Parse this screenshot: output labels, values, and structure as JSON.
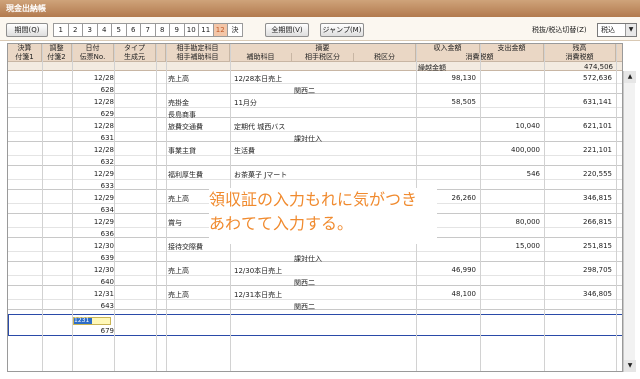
{
  "window": {
    "title": "現金出納帳"
  },
  "toolbar": {
    "period_label": "期間(Q)",
    "months": [
      "1",
      "2",
      "3",
      "4",
      "5",
      "6",
      "7",
      "8",
      "9",
      "10",
      "11",
      "12",
      "決"
    ],
    "selected_month": "12",
    "all_period_label": "全期間(V)",
    "jump_label": "ジャンプ(M)",
    "tax_mode_label": "税抜/税込切替(Z)",
    "tax_mode_value": "税込"
  },
  "header": {
    "row1": [
      "決算",
      "調整",
      "日付",
      "タイプ",
      "",
      "相手勘定科目",
      "摘要",
      "収入金額",
      "支出金額",
      "残高",
      ""
    ],
    "row2": [
      "付箋1",
      "付箋2",
      "伝票No.",
      "生成元",
      "",
      "相手補助科目",
      "補助科目",
      "相手税区分",
      "税区分",
      "消費税額",
      "消費税額"
    ],
    "carry_label": "繰越金額",
    "carry_value": "474,506"
  },
  "rows": [
    {
      "date": "12/28",
      "no": "628",
      "account": "売上高",
      "memo": "12/28本日売上",
      "sub2": "関西二",
      "income": "98,130",
      "expense": "",
      "balance": "572,636",
      "tax": ""
    },
    {
      "date": "12/28",
      "no": "629",
      "account": "売掛金",
      "memo": "11月分",
      "sub1": "長島商事",
      "income": "58,505",
      "expense": "",
      "balance": "631,141",
      "tax": ""
    },
    {
      "date": "12/28",
      "no": "631",
      "account": "旅費交通費",
      "memo": "定期代 城西バス",
      "sub2": "課対仕入",
      "income": "",
      "expense": "10,040",
      "balance": "621,101",
      "tax": ""
    },
    {
      "date": "12/28",
      "no": "632",
      "account": "事業主貸",
      "memo": "生活費",
      "income": "",
      "expense": "400,000",
      "balance": "221,101",
      "tax": ""
    },
    {
      "date": "12/29",
      "no": "633",
      "account": "福利厚生費",
      "memo": "お茶菓子 Jマート",
      "income": "",
      "expense": "546",
      "balance": "220,555",
      "tax": ""
    },
    {
      "date": "12/29",
      "no": "634",
      "account": "売上高",
      "memo": "",
      "income": "26,260",
      "expense": "",
      "balance": "346,815",
      "tax": ""
    },
    {
      "date": "12/29",
      "no": "636",
      "account": "賞与",
      "memo": "",
      "income": "",
      "expense": "80,000",
      "balance": "266,815",
      "tax": ""
    },
    {
      "date": "12/30",
      "no": "639",
      "account": "接待交際費",
      "memo": "",
      "sub2": "課対仕入",
      "income": "",
      "expense": "15,000",
      "balance": "251,815",
      "tax": ""
    },
    {
      "date": "12/30",
      "no": "640",
      "account": "売上高",
      "memo": "12/30本日売上",
      "sub2": "関西二",
      "income": "46,990",
      "expense": "",
      "balance": "298,705",
      "tax": ""
    },
    {
      "date": "12/31",
      "no": "643",
      "account": "売上高",
      "memo": "12/31本日売上",
      "sub2": "関西二",
      "income": "48,100",
      "expense": "",
      "balance": "346,805",
      "tax": ""
    }
  ],
  "input_row": {
    "date_value": "1231",
    "no": "679"
  },
  "overlay": {
    "line1": "領収証の入力もれに気がつき",
    "line2": "あわてて入力する。"
  },
  "colors": {
    "title_bg": "#b27a4e",
    "header_bg": "#ead7c5",
    "overlay_text": "#f08a2e",
    "selected_month": "#f3c6a8"
  }
}
